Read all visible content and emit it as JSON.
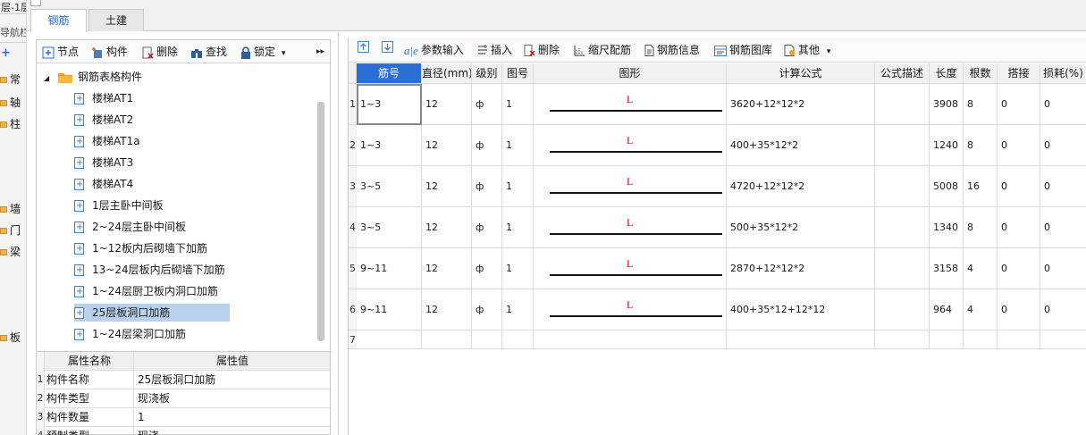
{
  "left_strip": {
    "top_text": "层-1层",
    "title": "导航栏",
    "plus": "+",
    "items": [
      {
        "label": "常"
      },
      {
        "label": "轴"
      },
      {
        "label": "柱"
      },
      {
        "label": "墙"
      },
      {
        "label": "门"
      },
      {
        "label": "梁"
      },
      {
        "label": "板"
      }
    ]
  },
  "tabs": [
    {
      "label": "钢筋",
      "active": true
    },
    {
      "label": "土建",
      "active": false
    }
  ],
  "left_toolbar": {
    "node": "节点",
    "component": "构件",
    "delete": "删除",
    "find": "查找",
    "lock": "锁定",
    "dropdown": "▾",
    "more": "▸▸"
  },
  "tree": {
    "root": {
      "label": "钢筋表格构件",
      "expanded": true
    },
    "items": [
      {
        "label": "楼梯AT1"
      },
      {
        "label": "楼梯AT2"
      },
      {
        "label": "楼梯AT1a"
      },
      {
        "label": "楼梯AT3"
      },
      {
        "label": "楼梯AT4"
      },
      {
        "label": "1层主卧中间板"
      },
      {
        "label": "2~24层主卧中间板"
      },
      {
        "label": "1~12板内后砌墙下加筋"
      },
      {
        "label": "13~24层板内后砌墙下加筋"
      },
      {
        "label": "1~24层厨卫板内洞口加筋"
      },
      {
        "label": "25层板洞口加筋",
        "selected": true
      },
      {
        "label": "1~24层梁洞口加筋"
      }
    ]
  },
  "properties": {
    "headers": {
      "name": "属性名称",
      "value": "属性值"
    },
    "rows": [
      {
        "n": "1",
        "name": "构件名称",
        "value": "25层板洞口加筋"
      },
      {
        "n": "2",
        "name": "构件类型",
        "value": "现浇板"
      },
      {
        "n": "3",
        "name": "构件数量",
        "value": "1"
      },
      {
        "n": "4",
        "name": "预制类型",
        "value": "现浇"
      }
    ]
  },
  "right_toolbar": {
    "up": "⇧",
    "down": "⇩",
    "param_input": "参数输入",
    "insert": "插入",
    "delete": "删除",
    "scale_rebar": "缩尺配筋",
    "rebar_info": "钢筋信息",
    "rebar_library": "钢筋图库",
    "other": "其他",
    "dropdown": "▾"
  },
  "grid": {
    "columns": [
      "筋号",
      "直径(mm)",
      "级别",
      "图号",
      "图形",
      "计算公式",
      "公式描述",
      "长度",
      "根数",
      "搭接",
      "损耗(%)"
    ],
    "rows": [
      {
        "n": "1",
        "bar_no": "1~3",
        "dia": "12",
        "grade": "ф",
        "fig": "1",
        "shape": "L",
        "formula": "3620+12*12*2",
        "desc": "",
        "length": "3908",
        "count": "8",
        "lap": "0",
        "loss": "0"
      },
      {
        "n": "2",
        "bar_no": "1~3",
        "dia": "12",
        "grade": "ф",
        "fig": "1",
        "shape": "L",
        "formula": "400+35*12*2",
        "desc": "",
        "length": "1240",
        "count": "8",
        "lap": "0",
        "loss": "0"
      },
      {
        "n": "3",
        "bar_no": "3~5",
        "dia": "12",
        "grade": "ф",
        "fig": "1",
        "shape": "L",
        "formula": "4720+12*12*2",
        "desc": "",
        "length": "5008",
        "count": "16",
        "lap": "0",
        "loss": "0"
      },
      {
        "n": "4",
        "bar_no": "3~5",
        "dia": "12",
        "grade": "ф",
        "fig": "1",
        "shape": "L",
        "formula": "500+35*12*2",
        "desc": "",
        "length": "1340",
        "count": "8",
        "lap": "0",
        "loss": "0"
      },
      {
        "n": "5",
        "bar_no": "9~11",
        "dia": "12",
        "grade": "ф",
        "fig": "1",
        "shape": "L",
        "formula": "2870+12*12*2",
        "desc": "",
        "length": "3158",
        "count": "4",
        "lap": "0",
        "loss": "0"
      },
      {
        "n": "6",
        "bar_no": "9~11",
        "dia": "12",
        "grade": "ф",
        "fig": "1",
        "shape": "L",
        "formula": "400+35*12+12*12",
        "desc": "",
        "length": "964",
        "count": "4",
        "lap": "0",
        "loss": "0"
      },
      {
        "n": "7",
        "bar_no": "",
        "dia": "",
        "grade": "",
        "fig": "",
        "shape": "",
        "formula": "",
        "desc": "",
        "length": "",
        "count": "",
        "lap": "",
        "loss": ""
      }
    ]
  },
  "colors": {
    "accent": "#2a6fd6",
    "selection": "#b8d1ef",
    "shape_label": "#d40000",
    "folder": "#e8b64b"
  }
}
